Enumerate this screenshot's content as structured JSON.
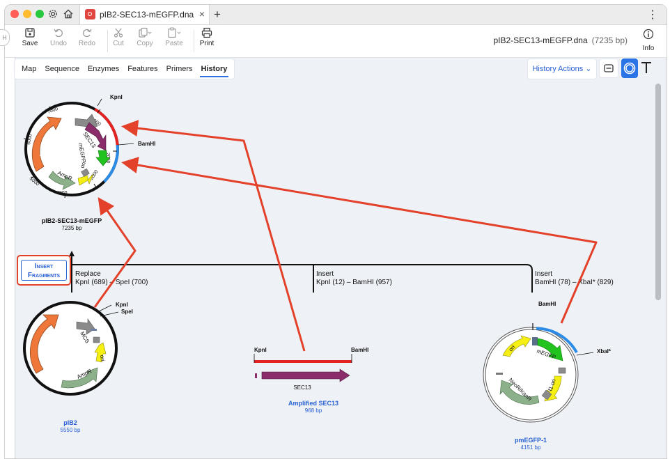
{
  "window": {
    "tab_title": "pIB2-SEC13-mEGFP.dna",
    "new_tab_symbol": "+",
    "close_symbol": "×",
    "menu_symbol": "⋮"
  },
  "toolbar": {
    "save": "Save",
    "undo": "Undo",
    "redo": "Redo",
    "cut": "Cut",
    "copy": "Copy",
    "paste": "Paste",
    "print": "Print",
    "info": "Info",
    "file_name": "pIB2-SEC13-mEGFP.dna",
    "file_size": "(7235 bp)"
  },
  "views": {
    "tabs": [
      "Map",
      "Sequence",
      "Enzymes",
      "Features",
      "Primers",
      "History"
    ],
    "active": "History"
  },
  "history_actions": {
    "label": "History Actions",
    "chevron": "⌄"
  },
  "left_handle": "H",
  "icons": {
    "gear": "gear-icon",
    "home": "home-icon",
    "linear_view": "linear-map-icon",
    "circular_view": "circular-map-icon",
    "text_view": "text-icon"
  },
  "colors": {
    "accent": "#2a62d4",
    "annotation_red": "#e3412a",
    "close": "#ff5f57",
    "minimize": "#febc2e",
    "maximize": "#28c840",
    "orange_feature": "#f0773a",
    "purple_feature": "#8b2d6b",
    "green_feature": "#22c21f",
    "yellow_feature": "#f5ef14",
    "gray_feature": "#8a8a8a",
    "sage_feature": "#8cb08a"
  },
  "history": {
    "product": {
      "name": "pIB2-SEC13-mEGFP",
      "size": "7235 bp",
      "ticks": [
        "1000",
        "2000",
        "3000",
        "4000",
        "5000",
        "6000",
        "7000"
      ],
      "features": [
        "PpHIS4",
        "SEC13",
        "mEGFP",
        "AmpR",
        "ori"
      ],
      "sites": [
        "KpnI",
        "BamHI"
      ]
    },
    "action": {
      "label_line1": "Insert",
      "label_line2": "Fragments"
    },
    "operations": [
      {
        "type": "Replace",
        "detail": "KpnI (689)  –  SpeI (700)"
      },
      {
        "type": "Insert",
        "detail": "KpnI (12)  –  BamHI (957)"
      },
      {
        "type": "Insert",
        "detail": "BamHI (78)  –  XbaI* (829)"
      }
    ],
    "sources": [
      {
        "name": "pIB2",
        "size": "5550 bp",
        "features": [
          "PpHIS4",
          "MCS",
          "AmpR",
          "ori"
        ],
        "sites": [
          "KpnI",
          "SpeI"
        ]
      },
      {
        "name": "Amplified SEC13",
        "size": "968 bp",
        "features": [
          "SEC13"
        ],
        "sites": [
          "KpnI",
          "BamHI"
        ]
      },
      {
        "name": "pmEGFP-1",
        "size": "4151 bp",
        "features": [
          "ori",
          "mEGFP",
          "f1 ori",
          "NeoR/KanR"
        ],
        "sites": [
          "BamHI",
          "XbaI*"
        ]
      }
    ]
  }
}
